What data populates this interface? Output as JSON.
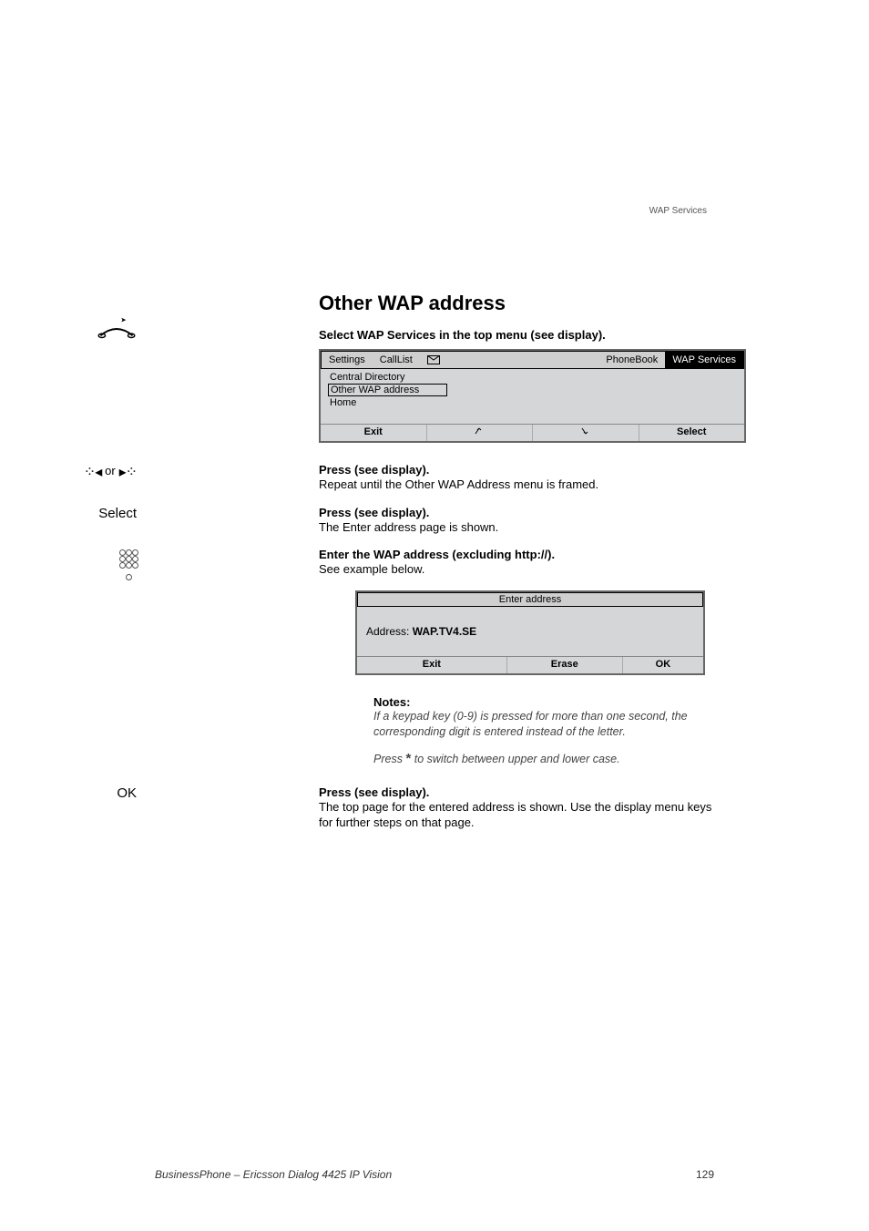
{
  "header": {
    "topic": "WAP Services"
  },
  "section": {
    "title": "Other WAP address"
  },
  "step1": {
    "instruction": "Select WAP Services in the top menu (see display)."
  },
  "display1": {
    "menu": {
      "settings": "Settings",
      "calllist": "CallList",
      "phonebook": "PhoneBook",
      "wap": "WAP Services"
    },
    "items": {
      "central": "Central Directory",
      "other": "Other WAP address",
      "home": "Home"
    },
    "softkeys": {
      "exit": "Exit",
      "select": "Select"
    }
  },
  "step2": {
    "left_or": "or",
    "instruction": "Press (see display).",
    "detail": "Repeat until the Other WAP Address menu is framed."
  },
  "step3": {
    "left": "Select",
    "instruction": "Press (see display).",
    "detail": "The Enter address page is shown."
  },
  "step4": {
    "instruction": "Enter the WAP address (excluding http://).",
    "detail": "See example below."
  },
  "display2": {
    "title": "Enter address",
    "address_label": "Address: ",
    "address_value": "WAP.TV4.SE",
    "softkeys": {
      "exit": "Exit",
      "erase": "Erase",
      "ok": "OK"
    }
  },
  "notes": {
    "heading": "Notes:",
    "line1": "If a keypad key (0-9) is pressed for more than one second, the corresponding digit is entered instead of the letter.",
    "line2a": "Press ",
    "star": "*",
    "line2b": " to switch between upper and lower case."
  },
  "step5": {
    "left": "OK",
    "instruction": "Press (see display).",
    "detail": "The top page for the entered address is shown. Use the display menu keys for further steps on that page."
  },
  "footer": {
    "product": "BusinessPhone – Ericsson Dialog 4425 IP Vision",
    "page": "129"
  }
}
